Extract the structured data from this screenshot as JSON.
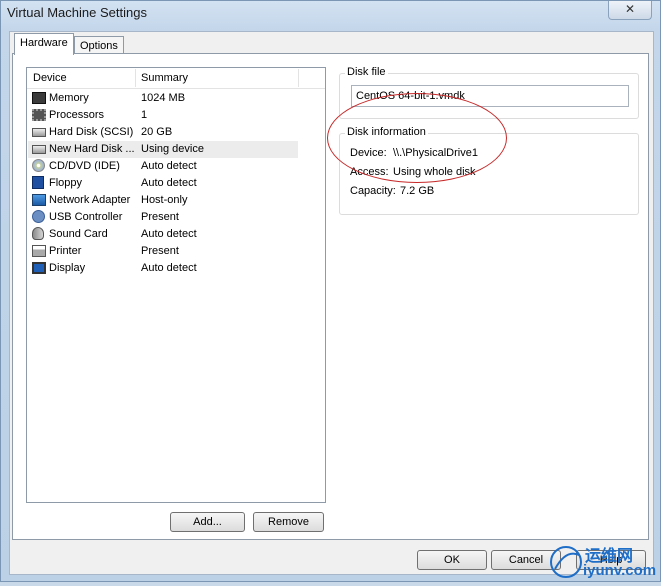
{
  "window": {
    "title": "Virtual Machine Settings",
    "close_glyph": "✕"
  },
  "tabs": [
    {
      "label": "Hardware"
    },
    {
      "label": "Options"
    }
  ],
  "device_list": {
    "columns": {
      "device": "Device",
      "summary": "Summary"
    },
    "rows": [
      {
        "device": "Memory",
        "summary": "1024 MB",
        "icon": "memory-icon"
      },
      {
        "device": "Processors",
        "summary": "1",
        "icon": "processor-icon"
      },
      {
        "device": "Hard Disk (SCSI)",
        "summary": "20 GB",
        "icon": "hard-disk-icon"
      },
      {
        "device": "New Hard Disk ...",
        "summary": "Using device",
        "icon": "hard-disk-icon",
        "selected": true
      },
      {
        "device": "CD/DVD (IDE)",
        "summary": "Auto detect",
        "icon": "cd-dvd-icon"
      },
      {
        "device": "Floppy",
        "summary": "Auto detect",
        "icon": "floppy-icon"
      },
      {
        "device": "Network Adapter",
        "summary": "Host-only",
        "icon": "network-adapter-icon"
      },
      {
        "device": "USB Controller",
        "summary": "Present",
        "icon": "usb-icon"
      },
      {
        "device": "Sound Card",
        "summary": "Auto detect",
        "icon": "sound-card-icon"
      },
      {
        "device": "Printer",
        "summary": "Present",
        "icon": "printer-icon"
      },
      {
        "device": "Display",
        "summary": "Auto detect",
        "icon": "display-icon"
      }
    ]
  },
  "buttons": {
    "add": "Add...",
    "remove": "Remove",
    "ok": "OK",
    "cancel": "Cancel",
    "help": "Help"
  },
  "disk_file": {
    "title": "Disk file",
    "value": "CentOS 64-bit-1.vmdk"
  },
  "disk_info": {
    "title": "Disk information",
    "device_label": "Device:",
    "device_value": "\\\\.\\PhysicalDrive1",
    "access_label": "Access:",
    "access_value": "Using whole disk",
    "capacity_label": "Capacity:",
    "capacity_value": "7.2 GB"
  },
  "watermark": {
    "text_cn": "运维网",
    "text_url": "iyunv.com"
  },
  "colors": {
    "annotation_red": "#c62828",
    "watermark_blue": "#1e6ec8"
  }
}
